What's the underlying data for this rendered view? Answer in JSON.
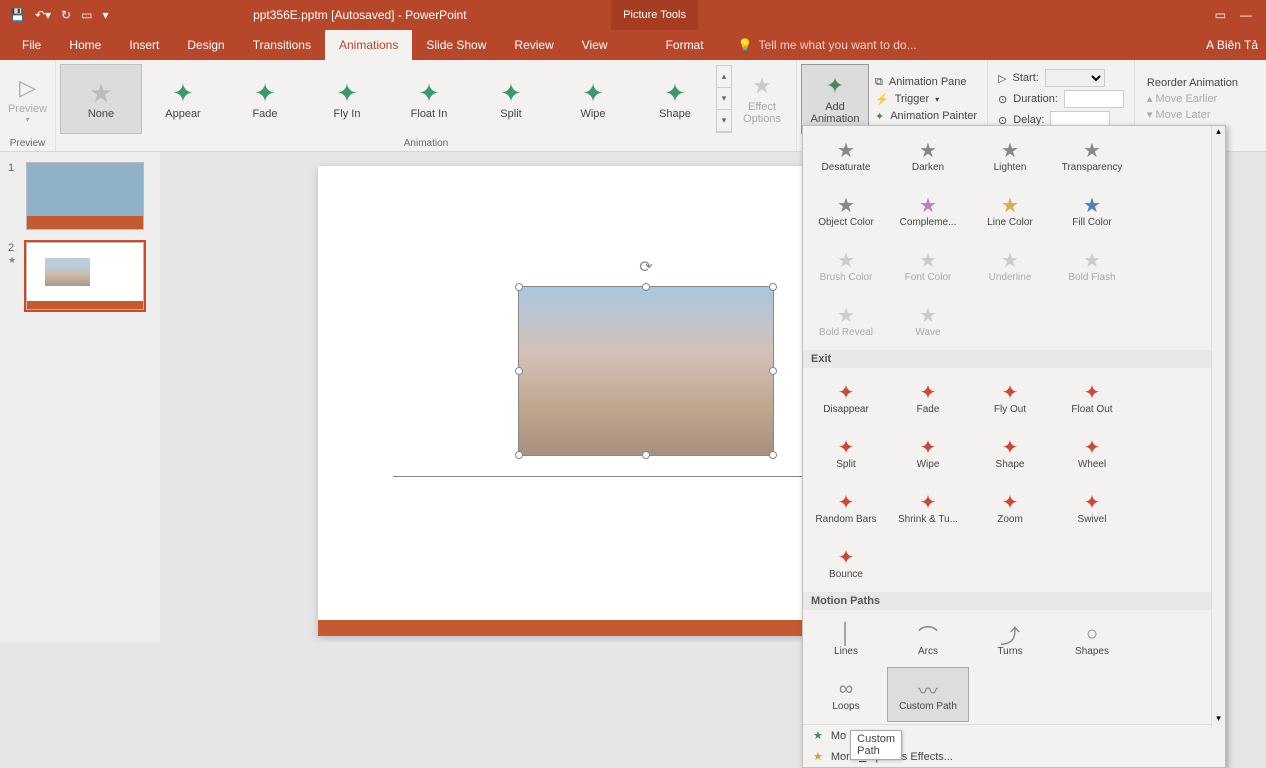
{
  "title": "ppt356E.pptm [Autosaved] - PowerPoint",
  "contextual_tab_group": "Picture Tools",
  "signin": "A Biên Tả",
  "tabs": {
    "file": "File",
    "home": "Home",
    "insert": "Insert",
    "design": "Design",
    "transitions": "Transitions",
    "animations": "Animations",
    "slideshow": "Slide Show",
    "review": "Review",
    "view": "View",
    "format": "Format"
  },
  "tellme": "Tell me what you want to do...",
  "ribbon": {
    "preview_group_label": "Preview",
    "preview_btn": "Preview",
    "animation_group_label": "Animation",
    "gallery": [
      {
        "label": "None"
      },
      {
        "label": "Appear"
      },
      {
        "label": "Fade"
      },
      {
        "label": "Fly In"
      },
      {
        "label": "Float In"
      },
      {
        "label": "Split"
      },
      {
        "label": "Wipe"
      },
      {
        "label": "Shape"
      }
    ],
    "effect_options": "Effect\nOptions",
    "add_animation": "Add\nAnimation",
    "advanced": {
      "pane": "Animation Pane",
      "trigger": "Trigger",
      "painter": "Animation Painter"
    },
    "timing": {
      "start": "Start:",
      "duration": "Duration:",
      "delay": "Delay:"
    },
    "reorder": {
      "title": "Reorder Animation",
      "earlier": "Move Earlier",
      "later": "Move Later"
    }
  },
  "slides": {
    "s1": "1",
    "s2": "2"
  },
  "dropdown": {
    "emphasis_items": [
      {
        "label": "Desaturate",
        "disabled": false
      },
      {
        "label": "Darken",
        "disabled": false
      },
      {
        "label": "Lighten",
        "disabled": false
      },
      {
        "label": "Transparency",
        "disabled": false
      },
      {
        "label": "Object Color",
        "disabled": false
      },
      {
        "label": "Compleme...",
        "disabled": false
      },
      {
        "label": "Line Color",
        "disabled": false
      },
      {
        "label": "Fill Color",
        "disabled": false
      },
      {
        "label": "Brush Color",
        "disabled": true
      },
      {
        "label": "Font Color",
        "disabled": true
      },
      {
        "label": "Underline",
        "disabled": true
      },
      {
        "label": "Bold Flash",
        "disabled": true
      },
      {
        "label": "Bold Reveal",
        "disabled": true
      },
      {
        "label": "Wave",
        "disabled": true
      }
    ],
    "exit_label": "Exit",
    "exit_items": [
      {
        "label": "Disappear"
      },
      {
        "label": "Fade"
      },
      {
        "label": "Fly Out"
      },
      {
        "label": "Float Out"
      },
      {
        "label": "Split"
      },
      {
        "label": "Wipe"
      },
      {
        "label": "Shape"
      },
      {
        "label": "Wheel"
      },
      {
        "label": "Random Bars"
      },
      {
        "label": "Shrink & Tu..."
      },
      {
        "label": "Zoom"
      },
      {
        "label": "Swivel"
      },
      {
        "label": "Bounce"
      }
    ],
    "motion_label": "Motion Paths",
    "motion_items": [
      {
        "label": "Lines"
      },
      {
        "label": "Arcs"
      },
      {
        "label": "Turns"
      },
      {
        "label": "Shapes"
      },
      {
        "label": "Loops"
      },
      {
        "label": "Custom Path"
      }
    ],
    "tooltip": "Custom Path",
    "more_entrance": "More Entrance Effects...",
    "more_emphasis": "More Emphasis Effects...",
    "more_entrance_vis": "Mo",
    "more_entrance_vis2": "ects...",
    "more_emphasis_u": "E"
  }
}
